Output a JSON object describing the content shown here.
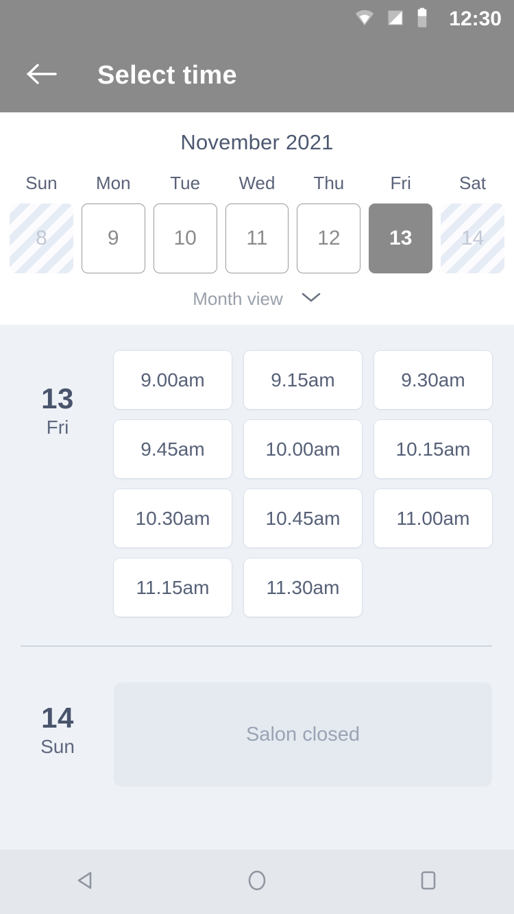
{
  "status_bar": {
    "time": "12:30",
    "icons": [
      "wifi-icon",
      "cellular-signal-icon",
      "battery-icon"
    ]
  },
  "app_bar": {
    "back_icon": "arrow-left-icon",
    "title": "Select time"
  },
  "calendar": {
    "month_label": "November 2021",
    "weekdays": [
      "Sun",
      "Mon",
      "Tue",
      "Wed",
      "Thu",
      "Fri",
      "Sat"
    ],
    "days": [
      {
        "number": "8",
        "state": "disabled"
      },
      {
        "number": "9",
        "state": "available"
      },
      {
        "number": "10",
        "state": "available"
      },
      {
        "number": "11",
        "state": "available"
      },
      {
        "number": "12",
        "state": "available"
      },
      {
        "number": "13",
        "state": "selected"
      },
      {
        "number": "14",
        "state": "disabled"
      }
    ],
    "view_toggle": {
      "label": "Month view",
      "icon": "chevron-down-icon"
    }
  },
  "schedule": {
    "groups": [
      {
        "day_number": "13",
        "day_name": "Fri",
        "type": "slots",
        "slots": [
          "9.00am",
          "9.15am",
          "9.30am",
          "9.45am",
          "10.00am",
          "10.15am",
          "10.30am",
          "10.45am",
          "11.00am",
          "11.15am",
          "11.30am"
        ]
      },
      {
        "day_number": "14",
        "day_name": "Sun",
        "type": "closed",
        "closed_message": "Salon closed"
      }
    ]
  },
  "nav_bar": {
    "buttons": [
      {
        "name": "back-nav-button",
        "icon": "triangle-left-icon"
      },
      {
        "name": "home-nav-button",
        "icon": "circle-icon"
      },
      {
        "name": "recents-nav-button",
        "icon": "square-icon"
      }
    ]
  },
  "colors": {
    "app_bar": "#8a8a8a",
    "page_bg": "#eef2f7",
    "panel_bg": "#ffffff",
    "text_primary": "#4d5871",
    "text_muted": "#9aa0ab",
    "selected_day": "#8a8a8a"
  }
}
